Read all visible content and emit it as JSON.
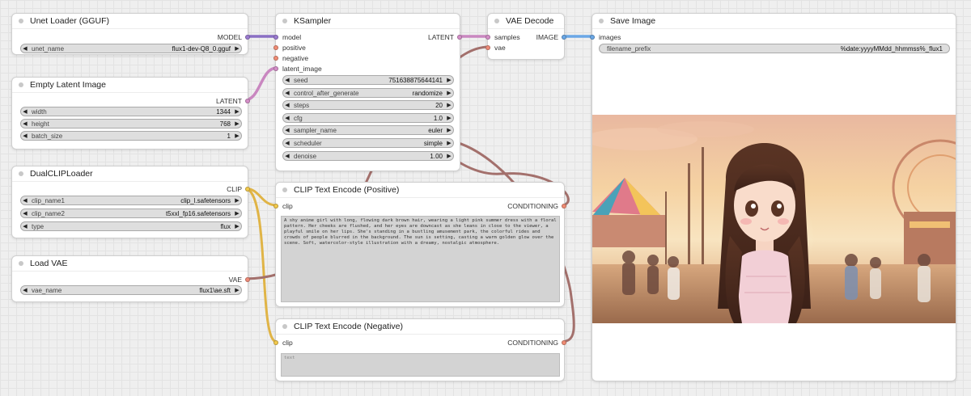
{
  "nodes": {
    "unet_loader": {
      "title": "Unet Loader (GGUF)",
      "output": "MODEL",
      "widgets": [
        {
          "name": "unet_name",
          "value": "flux1-dev-Q8_0.gguf"
        }
      ]
    },
    "empty_latent": {
      "title": "Empty Latent Image",
      "output": "LATENT",
      "widgets": [
        {
          "name": "width",
          "value": "1344"
        },
        {
          "name": "height",
          "value": "768"
        },
        {
          "name": "batch_size",
          "value": "1"
        }
      ]
    },
    "dual_clip": {
      "title": "DualCLIPLoader",
      "output": "CLIP",
      "widgets": [
        {
          "name": "clip_name1",
          "value": "clip_l.safetensors"
        },
        {
          "name": "clip_name2",
          "value": "t5xxl_fp16.safetensors"
        },
        {
          "name": "type",
          "value": "flux"
        }
      ]
    },
    "load_vae": {
      "title": "Load VAE",
      "output": "VAE",
      "widgets": [
        {
          "name": "vae_name",
          "value": "flux1\\ae.sft"
        }
      ]
    },
    "ksampler": {
      "title": "KSampler",
      "output": "LATENT",
      "inputs": [
        "model",
        "positive",
        "negative",
        "latent_image"
      ],
      "widgets": [
        {
          "name": "seed",
          "value": "751638875644141"
        },
        {
          "name": "control_after_generate",
          "value": "randomize"
        },
        {
          "name": "steps",
          "value": "20"
        },
        {
          "name": "cfg",
          "value": "1.0"
        },
        {
          "name": "sampler_name",
          "value": "euler"
        },
        {
          "name": "scheduler",
          "value": "simple"
        },
        {
          "name": "denoise",
          "value": "1.00"
        }
      ]
    },
    "clip_pos": {
      "title": "CLIP Text Encode (Positive)",
      "input": "clip",
      "output": "CONDITIONING",
      "text": "A shy anime girl with long, flowing dark brown hair, wearing a light pink summer dress with a floral pattern. Her cheeks are flushed, and her eyes are downcast as she leans in close to the viewer, a playful smile on her lips. She's standing in a bustling amusement park, the colorful rides and crowds of people blurred in the background. The sun is setting, casting a warm golden glow over the scene. Soft, watercolor-style illustration with a dreamy, nostalgic atmosphere."
    },
    "clip_neg": {
      "title": "CLIP Text Encode (Negative)",
      "input": "clip",
      "output": "CONDITIONING",
      "placeholder": "text"
    },
    "vae_decode": {
      "title": "VAE Decode",
      "inputs": [
        "samples",
        "vae"
      ],
      "output": "IMAGE"
    },
    "save_image": {
      "title": "Save Image",
      "input": "images",
      "widgets": [
        {
          "name": "filename_prefix",
          "value": "%date:yyyyMMdd_hhmmss%_flux1"
        }
      ]
    }
  },
  "colors": {
    "model_link": "#9b7bd0",
    "latent_link": "#d58fc8",
    "conditioning_link": "#b07a74",
    "clip_link": "#e3b94a",
    "vae_link": "#b07a74",
    "image_link": "#6aa7e6"
  }
}
